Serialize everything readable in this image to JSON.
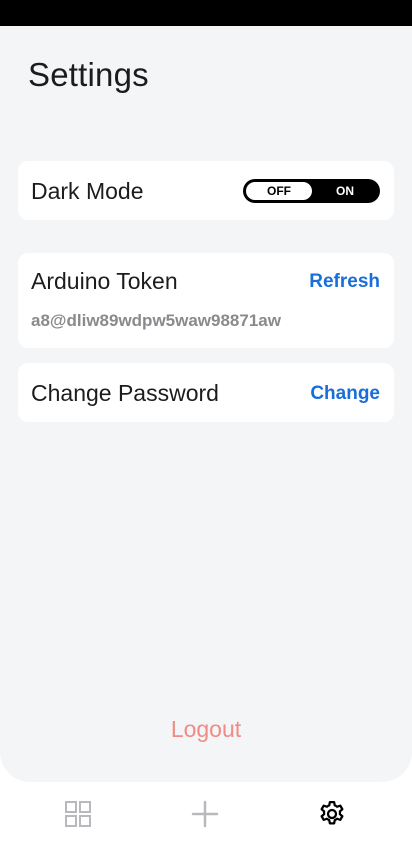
{
  "page": {
    "title": "Settings"
  },
  "settings": {
    "dark_mode": {
      "label": "Dark Mode",
      "toggle_off_label": "OFF",
      "toggle_on_label": "ON",
      "state": "off"
    },
    "arduino_token": {
      "label": "Arduino Token",
      "action_label": "Refresh",
      "value": "a8@dliw89wdpw5waw98871aw"
    },
    "change_password": {
      "label": "Change Password",
      "action_label": "Change"
    }
  },
  "logout_label": "Logout",
  "tab_bar": {
    "items": [
      {
        "icon": "grid-icon",
        "active": false
      },
      {
        "icon": "plus-icon",
        "active": false
      },
      {
        "icon": "gear-icon",
        "active": true
      }
    ]
  },
  "colors": {
    "accent": "#1a6ed8",
    "logout": "#f28a85",
    "background": "#f4f5f7",
    "card": "#ffffff",
    "inactive_icon": "#b9b9bd"
  }
}
